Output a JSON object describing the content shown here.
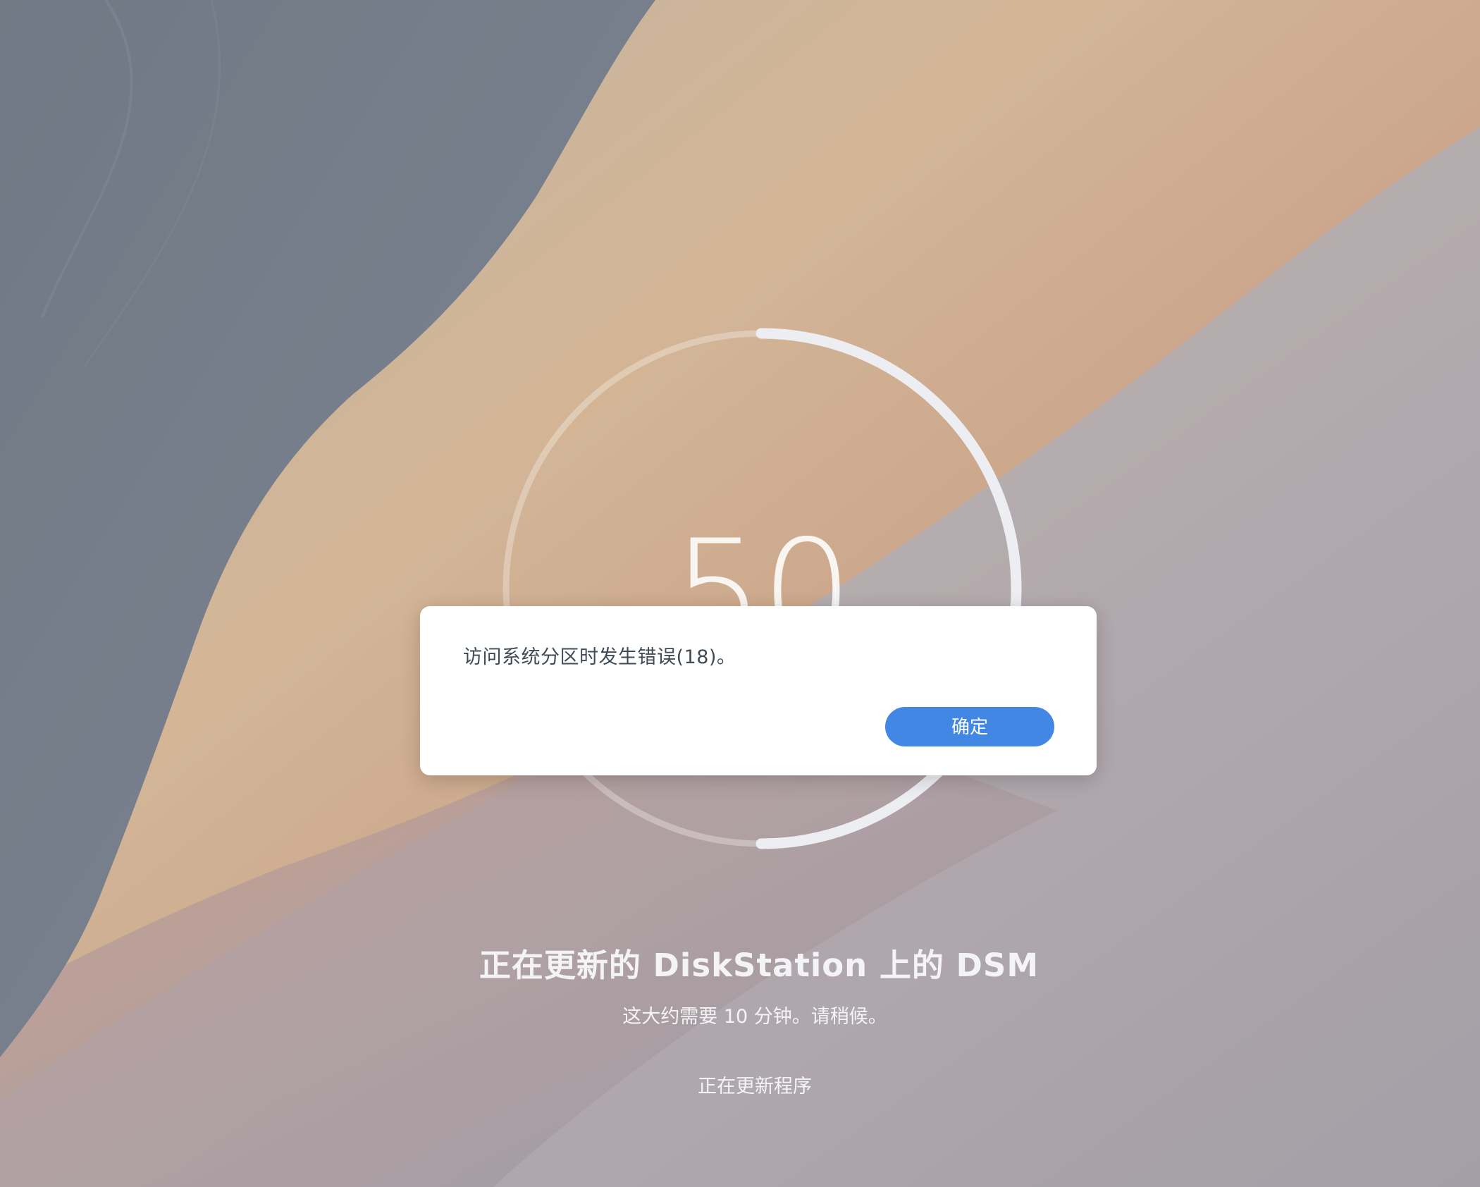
{
  "progress": {
    "percent_label": "50",
    "fraction": 0.5
  },
  "update": {
    "title": "正在更新的 DiskStation 上的 DSM",
    "subtitle": "这大约需要 10 分钟。请稍候。",
    "status": "正在更新程序"
  },
  "dialog": {
    "message": "访问系统分区时发生错误(18)。",
    "ok_label": "确定"
  },
  "colors": {
    "accent": "#4187e3",
    "dialog_text": "#414b55",
    "overlay_text": "#f4f4f6"
  }
}
